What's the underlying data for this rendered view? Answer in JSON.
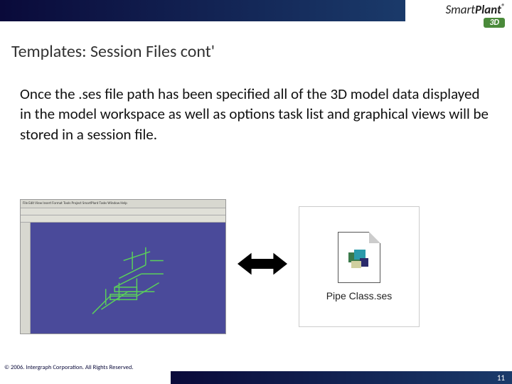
{
  "brand": {
    "name_light": "Smart",
    "name_bold": "Plant",
    "reg": "®",
    "sub": "3D"
  },
  "slide": {
    "title": "Templates: Session Files cont'",
    "body": "Once the .ses file path has been specified all of the 3D model data displayed in the  model workspace as well as options task list and graphical views will be stored in a session file."
  },
  "thumb": {
    "menubar": "File Edit View Insert Format Tools Project SmartPlant Tasks Window Help"
  },
  "file": {
    "label": "Pipe Class.ses"
  },
  "footer": {
    "copyright": "© 2006. Intergraph Corporation. All Rights Reserved.",
    "page": "11"
  }
}
